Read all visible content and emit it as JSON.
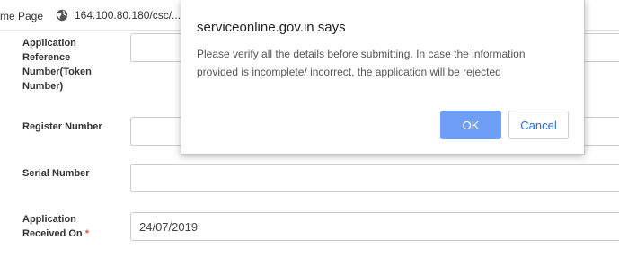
{
  "browser": {
    "bookmark_page": "me Page",
    "bookmark_site": "164.100.80.180/csc/..."
  },
  "form": {
    "fields": [
      {
        "label": "Application Reference Number(Token Number)",
        "value": ""
      },
      {
        "label": "Register Number",
        "value": ""
      },
      {
        "label": "Serial Number",
        "value": ""
      },
      {
        "label": "Application Received On",
        "required_marker": "*",
        "value": "24/07/2019"
      }
    ]
  },
  "dialog": {
    "title": "serviceonline.gov.in says",
    "message": "Please verify all the details before submitting. In case the information provided is incomplete/ incorrect, the application will be rejected",
    "ok_label": "OK",
    "cancel_label": "Cancel"
  },
  "colors": {
    "ok_button": "#6f9ef7",
    "cancel_text": "#2a6fdb",
    "required_marker": "#d9534f",
    "cursor_highlight": "#fff046"
  }
}
